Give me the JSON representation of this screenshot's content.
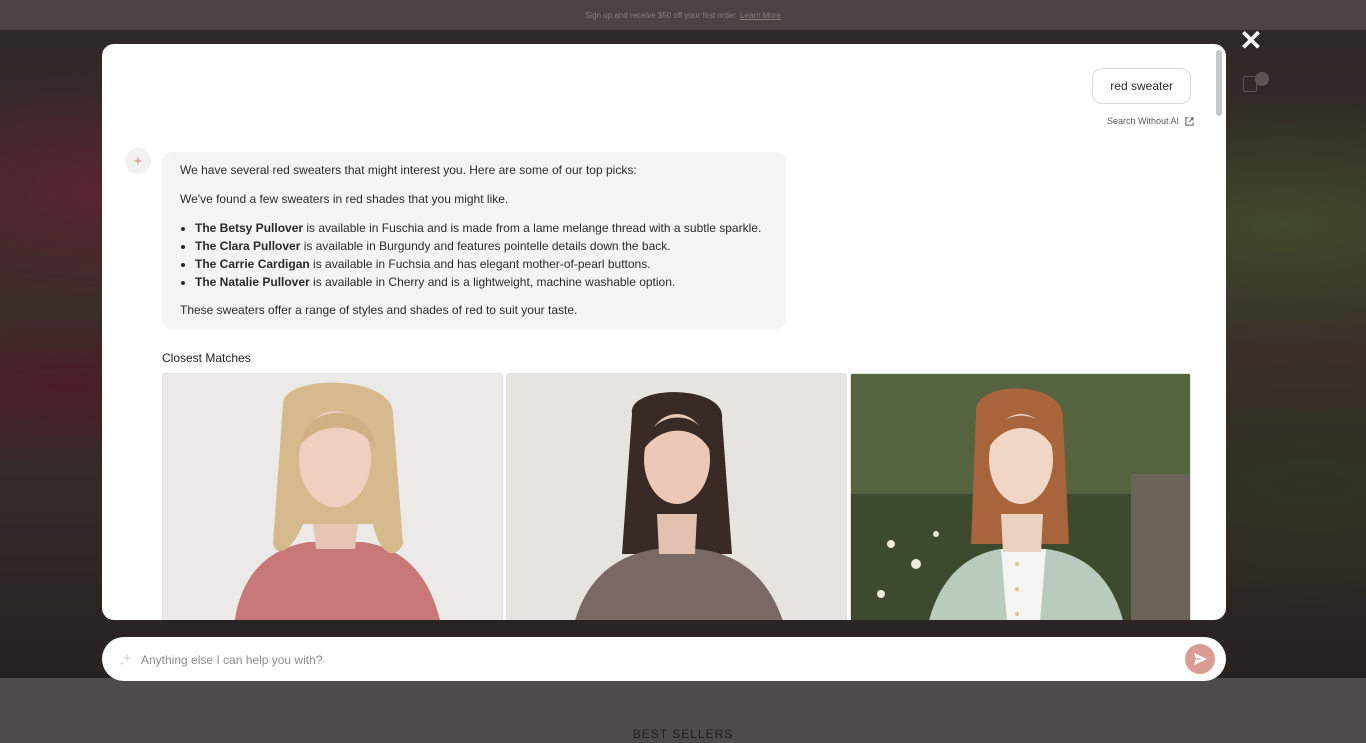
{
  "announcement": {
    "text": "Sign up and receive $50 off your first order",
    "link": "Learn More"
  },
  "page": {
    "section_title": "BEST SELLERS"
  },
  "modal": {
    "close_icon": "close-icon",
    "query": "red sweater",
    "search_without_ai": "Search Without AI",
    "answer": {
      "intro": "We have several red sweaters that might interest you. Here are some of our top picks:",
      "lead": "We've found a few sweaters in red shades that you might like.",
      "items": [
        {
          "name": "The Betsy Pullover",
          "desc": " is available in Fuschia and is made from a lame melange thread with a subtle sparkle."
        },
        {
          "name": "The Clara Pullover",
          "desc": " is available in Burgundy and features pointelle details down the back."
        },
        {
          "name": "The Carrie Cardigan",
          "desc": " is available in Fuchsia and has elegant mother-of-pearl buttons."
        },
        {
          "name": "The Natalie Pullover",
          "desc": " is available in Cherry and is a lightweight, machine washable option."
        }
      ],
      "closing": "These sweaters offer a range of styles and shades of red to suit your taste."
    },
    "closest_matches_title": "Closest Matches",
    "products": [
      {
        "image": "woman-pink-sweater",
        "sweater_color": "#c9787a"
      },
      {
        "image": "woman-taupe-sweater",
        "sweater_color": "#7a6865"
      },
      {
        "image": "woman-mint-cardigan",
        "sweater_color": "#b9cbbd"
      }
    ]
  },
  "chat": {
    "placeholder": "Anything else I can help you with?",
    "send_icon": "send-icon",
    "sparkle_icon": "sparkle-icon"
  },
  "colors": {
    "accent": "#d99c95",
    "overlay": "#3a3836"
  }
}
